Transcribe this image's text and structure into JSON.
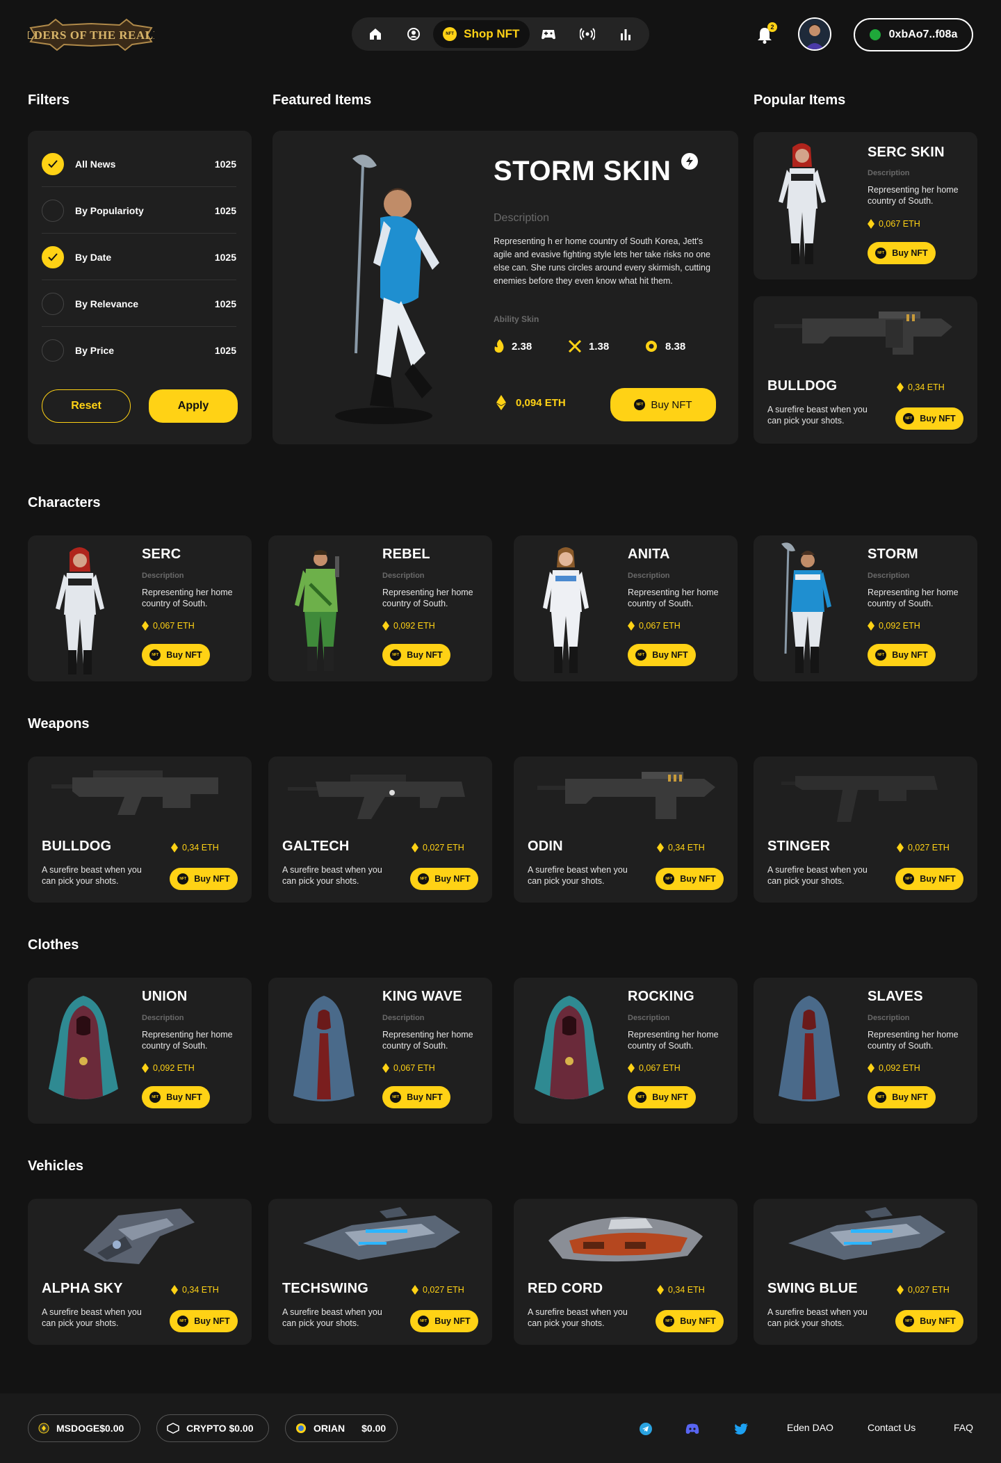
{
  "header": {
    "logo_text": "ELDERS OF THE REALM",
    "nav_active_label": "Shop NFT",
    "nav_icons": [
      "home-icon",
      "profile-icon",
      "nft-icon",
      "gamepad-icon",
      "broadcast-icon",
      "stats-icon"
    ],
    "notification_count": "2",
    "wallet_address": "0xbAo7..f08a"
  },
  "sections": {
    "filters": "Filters",
    "featured": "Featured Items",
    "popular": "Popular Items",
    "characters": "Characters",
    "weapons": "Weapons",
    "clothes": "Clothes",
    "vehicles": "Vehicles"
  },
  "filters": {
    "items": [
      {
        "label": "All News",
        "count": "1025",
        "checked": true
      },
      {
        "label": "By Populariоty",
        "count": "1025",
        "checked": false
      },
      {
        "label": "By Date",
        "count": "1025",
        "checked": true
      },
      {
        "label": "By Relevance",
        "count": "1025",
        "checked": false
      },
      {
        "label": "By Price",
        "count": "1025",
        "checked": false
      }
    ],
    "reset_label": "Reset",
    "apply_label": "Apply"
  },
  "featured": {
    "title": "STORM SKIN",
    "desc_heading": "Description",
    "description": "Representing h er home country of South Korea, Jett's agile and evasive fighting style lets her take risks no one else can. She runs circles around every skirmish, cutting enemies before they even know what hit them.",
    "ability_heading": "Ability Skin",
    "abilities": [
      "2.38",
      "1.38",
      "8.38"
    ],
    "price": "0,094 ETH",
    "buy_label": "Buy NFT"
  },
  "popular": {
    "item1": {
      "title": "SERC SKIN",
      "desc_heading": "Description",
      "description": "Representing her home country of South.",
      "price": "0,067 ETH",
      "buy_label": "Buy NFT"
    },
    "item2": {
      "title": "BULLDOG",
      "price": "0,34 ETH",
      "description": "A surefire beast when you can pick your shots.",
      "buy_label": "Buy NFT"
    }
  },
  "characters": [
    {
      "title": "SERC",
      "desc_heading": "Description",
      "description": "Representing her home country of South.",
      "price": "0,067 ETH",
      "buy_label": "Buy NFT"
    },
    {
      "title": "REBEL",
      "desc_heading": "Description",
      "description": "Representing her home country of South.",
      "price": "0,092 ETH",
      "buy_label": "Buy NFT"
    },
    {
      "title": "ANITA",
      "desc_heading": "Description",
      "description": "Representing her home country of South.",
      "price": "0,067 ETH",
      "buy_label": "Buy NFT"
    },
    {
      "title": "STORM",
      "desc_heading": "Description",
      "description": "Representing her home country of South.",
      "price": "0,092 ETH",
      "buy_label": "Buy NFT"
    }
  ],
  "weapons": [
    {
      "title": "BULLDOG",
      "price": "0,34 ETH",
      "description": "A surefire beast when you can pick your shots.",
      "buy_label": "Buy NFT"
    },
    {
      "title": "GALTECH",
      "price": "0,027 ETH",
      "description": "A surefire beast when you can pick your shots.",
      "buy_label": "Buy NFT"
    },
    {
      "title": "ODIN",
      "price": "0,34 ETH",
      "description": "A surefire beast when you can pick your shots.",
      "buy_label": "Buy NFT"
    },
    {
      "title": "STINGER",
      "price": "0,027 ETH",
      "description": "A surefire beast when you can pick your shots.",
      "buy_label": "Buy NFT"
    }
  ],
  "clothes": [
    {
      "title": "UNION",
      "desc_heading": "Description",
      "description": "Representing her home country of South.",
      "price": "0,092 ETH",
      "buy_label": "Buy NFT"
    },
    {
      "title": "KING WAVE",
      "desc_heading": "Description",
      "description": "Representing her home country of South.",
      "price": "0,067 ETH",
      "buy_label": "Buy NFT"
    },
    {
      "title": "ROCKING",
      "desc_heading": "Description",
      "description": "Representing her home country of South.",
      "price": "0,067 ETH",
      "buy_label": "Buy NFT"
    },
    {
      "title": "SLAVES",
      "desc_heading": "Description",
      "description": "Representing her home country of South.",
      "price": "0,092 ETH",
      "buy_label": "Buy NFT"
    }
  ],
  "vehicles": [
    {
      "title": "ALPHA SKY",
      "price": "0,34 ETH",
      "description": "A surefire beast when you can pick your shots.",
      "buy_label": "Buy NFT"
    },
    {
      "title": "TECHSWING",
      "price": "0,027 ETH",
      "description": "A surefire beast when you can pick your shots.",
      "buy_label": "Buy NFT"
    },
    {
      "title": "RED CORD",
      "price": "0,34 ETH",
      "description": "A surefire beast when you can pick your shots.",
      "buy_label": "Buy NFT"
    },
    {
      "title": "SWING BLUE",
      "price": "0,027 ETH",
      "description": "A surefire beast when you can pick your shots.",
      "buy_label": "Buy NFT"
    }
  ],
  "footer": {
    "coins": [
      {
        "label": "MSDOGE$0.00"
      },
      {
        "label": "CRYPTO $0.00"
      },
      {
        "name": "ORIAN",
        "value": "$0.00"
      }
    ],
    "social_icons": [
      "telegram-icon",
      "discord-icon",
      "twitter-icon"
    ],
    "links": [
      "Eden DAO",
      "Contact Us",
      "FAQ"
    ]
  },
  "colors": {
    "accent": "#FFD215",
    "background": "#131313",
    "card": "#1f1f1f"
  }
}
